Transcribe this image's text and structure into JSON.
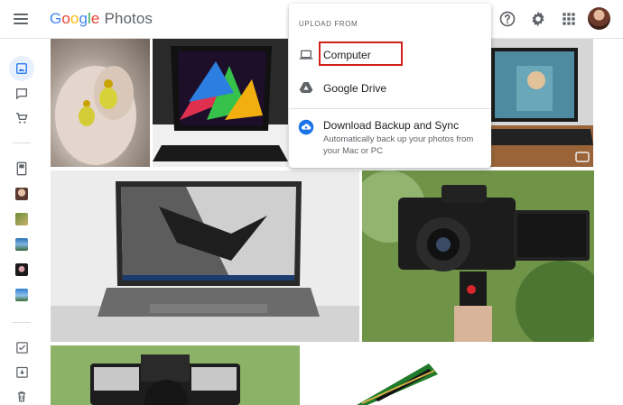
{
  "header": {
    "logo_google": [
      "G",
      "o",
      "o",
      "g",
      "l",
      "e"
    ],
    "logo_product": "Photos"
  },
  "upload_menu": {
    "heading": "UPLOAD FROM",
    "items": [
      {
        "label": "Computer",
        "icon": "laptop-icon"
      },
      {
        "label": "Google Drive",
        "icon": "google-drive-icon"
      },
      {
        "label": "Download Backup and Sync",
        "icon": "backup-sync-icon",
        "description": "Automatically back up your photos from your Mac or PC"
      }
    ]
  },
  "sidebar": {
    "items": [
      "photos-icon",
      "chat-icon",
      "cart-icon",
      "photo-book-icon",
      "person-thumb-1",
      "person-thumb-2",
      "person-thumb-3",
      "person-thumb-4",
      "person-thumb-5",
      "checklist-icon",
      "archive-icon",
      "trash-icon"
    ]
  },
  "photos": {
    "items": [
      "earrings",
      "razer-laptop",
      "gaming-laptop-game",
      "asus-rog-laptop",
      "lumix-camera",
      "olympus-camera",
      "ram-stick"
    ]
  },
  "colors": {
    "accent_blue": "#1a73e8",
    "highlight_red": "#d0201b"
  }
}
